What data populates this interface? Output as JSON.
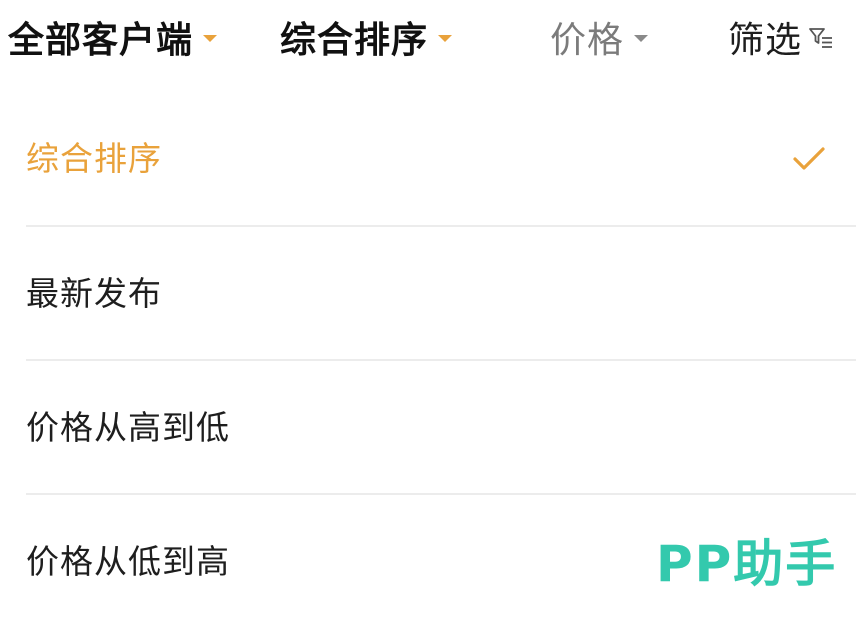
{
  "filter_bar": {
    "tabs": [
      {
        "label": "全部客户端",
        "state": "active",
        "icon": "caret-down-icon"
      },
      {
        "label": "综合排序",
        "state": "active",
        "icon": "caret-down-icon"
      },
      {
        "label": "价格",
        "state": "inactive",
        "icon": "caret-down-icon"
      },
      {
        "label": "筛选",
        "state": "inactive",
        "icon": "funnel-icon"
      }
    ]
  },
  "sort_menu": {
    "items": [
      {
        "label": "综合排序",
        "selected": true,
        "icon": "check-icon"
      },
      {
        "label": "最新发布",
        "selected": false
      },
      {
        "label": "价格从高到低",
        "selected": false
      },
      {
        "label": "价格从低到高",
        "selected": false
      }
    ]
  },
  "watermark": {
    "text": "PP助手"
  },
  "colors": {
    "accent": "#e9a23b",
    "text_primary": "#1e1e1e",
    "text_muted": "#7b7b7b",
    "divider": "#ececec",
    "watermark": "#33c9ad"
  }
}
